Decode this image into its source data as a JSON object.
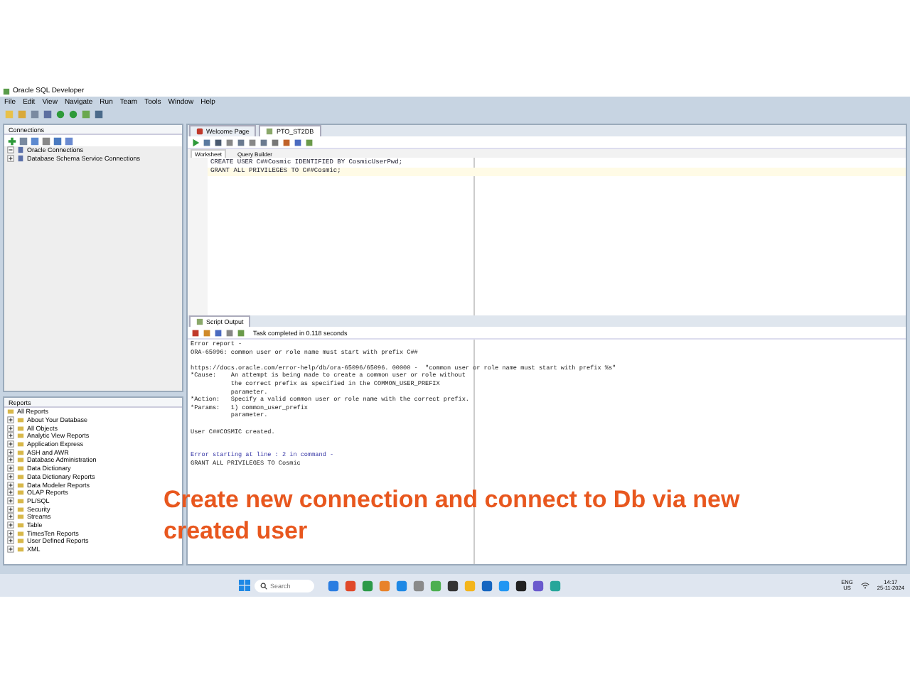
{
  "window": {
    "title": "Oracle SQL Developer"
  },
  "menu": [
    "File",
    "Edit",
    "View",
    "Navigate",
    "Run",
    "Team",
    "Tools",
    "Window",
    "Help"
  ],
  "connections": {
    "title": "Connections",
    "items": [
      {
        "label": "Oracle Connections",
        "expanded": true
      },
      {
        "label": "Database Schema Service Connections",
        "expanded": false
      }
    ]
  },
  "reports": {
    "title": "Reports",
    "root": {
      "label": "All Reports",
      "children": [
        {
          "label": "About Your Database",
          "expanded": false
        },
        {
          "label": "All Objects",
          "expanded": false
        },
        {
          "label": "Analytic View Reports",
          "expanded": false
        },
        {
          "label": "Application Express",
          "expanded": false
        },
        {
          "label": "ASH and AWR",
          "expanded": false
        },
        {
          "label": "Database Administration",
          "expanded": false
        },
        {
          "label": "Data Dictionary",
          "expanded": false
        },
        {
          "label": "Data Dictionary Reports",
          "expanded": false
        },
        {
          "label": "Data Modeler Reports",
          "expanded": false
        },
        {
          "label": "OLAP Reports",
          "expanded": false
        },
        {
          "label": "PL/SQL",
          "expanded": false
        },
        {
          "label": "Security",
          "expanded": false
        },
        {
          "label": "Streams",
          "expanded": false
        },
        {
          "label": "Table",
          "expanded": false
        },
        {
          "label": "TimesTen Reports",
          "expanded": false
        },
        {
          "label": "User Defined Reports",
          "expanded": false
        },
        {
          "label": "XML",
          "expanded": false
        }
      ]
    }
  },
  "editor_tabs": [
    {
      "label": "Welcome Page",
      "kind": "welcome",
      "selected": false
    },
    {
      "label": "PTO_ST2DB",
      "kind": "sql",
      "selected": true
    }
  ],
  "sub_tabs": [
    {
      "label": "Worksheet",
      "selected": true
    },
    {
      "label": "Query Builder",
      "selected": false
    }
  ],
  "editor_lines": [
    {
      "text": "CREATE USER C##Cosmic IDENTIFIED BY CosmicUserPwd;",
      "current": false
    },
    {
      "text": "GRANT ALL PRIVILEGES TO C##Cosmic;",
      "current": true
    }
  ],
  "output": {
    "tab": "Script Output",
    "status": "Task completed in 0.118 seconds",
    "lines": [
      {
        "text": "Error report -",
        "kind": "plain"
      },
      {
        "text": "ORA-65096: common user or role name must start with prefix C##",
        "kind": "plain"
      },
      {
        "kind": "blank"
      },
      {
        "text": "https://docs.oracle.com/error-help/db/ora-65096/65096. 00000 -  \"common user or role name must start with prefix %s\"",
        "kind": "plain"
      },
      {
        "text": "*Cause:    An attempt is being made to create a common user or role without",
        "kind": "plain"
      },
      {
        "text": "           the correct prefix as specified in the COMMON_USER_PREFIX",
        "kind": "plain"
      },
      {
        "text": "           parameter.",
        "kind": "plain"
      },
      {
        "text": "*Action:   Specify a valid common user or role name with the correct prefix.",
        "kind": "plain"
      },
      {
        "text": "*Params:   1) common_user_prefix",
        "kind": "plain"
      },
      {
        "text": "           parameter.",
        "kind": "plain"
      },
      {
        "kind": "blank"
      },
      {
        "text": "User C##COSMIC created.",
        "kind": "plain"
      },
      {
        "kind": "blank"
      },
      {
        "kind": "blank"
      },
      {
        "text": "Error starting at line : 2 in command -",
        "kind": "error"
      },
      {
        "text": "GRANT ALL PRIVILEGES TO Cosmic",
        "kind": "plain"
      }
    ]
  },
  "caption": "Create new connection and connect to Db via new created user",
  "taskbar": {
    "search_placeholder": "Search",
    "language": "ENG",
    "region": "US",
    "time": "14:17",
    "date": "25-11-2024"
  }
}
